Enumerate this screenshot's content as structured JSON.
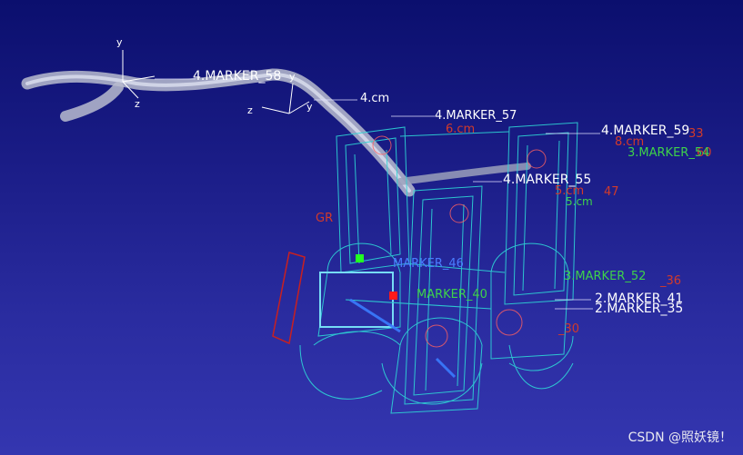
{
  "scene": {
    "white_labels": [
      "4.MARKER_58",
      "4.cm",
      "4.MARKER_57",
      "4.MARKER_59",
      "4.MARKER_55",
      "2.MARKER_41",
      "2.MARKER_35"
    ],
    "red_labels": [
      "6.cm",
      "8.cm",
      "60",
      "33",
      "5.cm",
      "47",
      "_36",
      "_30"
    ],
    "green_labels": [
      "3.MARKER_54",
      "3.MARKER_52",
      "5.cm",
      "GR"
    ],
    "blue_labels": [
      "MARKER_46",
      "MARKER_40"
    ],
    "axis_labels": [
      "y",
      "z",
      "y",
      "z",
      "y"
    ]
  },
  "colors": {
    "background_top": "#0b0f6e",
    "background_bottom": "#3436b0",
    "wireframe": "#2ed6d6",
    "label_white": "#ffffff",
    "label_red": "#d23a2a",
    "label_green": "#3ed24a",
    "label_blue": "#4a7cff"
  },
  "watermark": "CSDN @照妖镜！"
}
